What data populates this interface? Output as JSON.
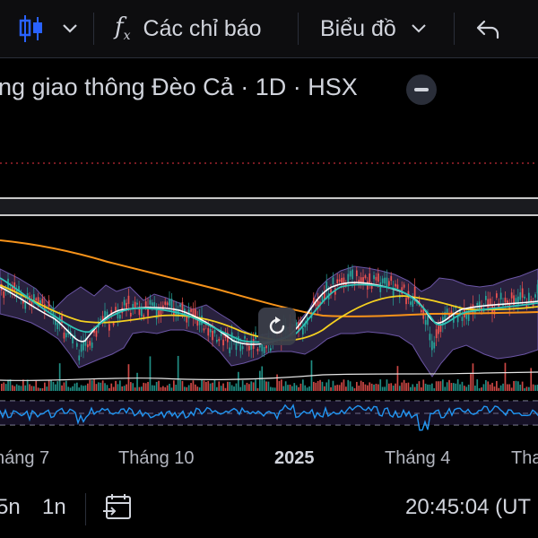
{
  "toolbar": {
    "chart_type_icon": "candlestick-icon",
    "dropdown_icon": "chevron-down-icon",
    "indicators_icon": "fx-icon",
    "indicators_label": "Các chỉ báo",
    "chart_menu_label": "Biểu đồ",
    "undo_icon": "undo-icon"
  },
  "symbol": {
    "title": "ng giao thông Đèo Cả · 1D · HSX",
    "collapse_icon": "minus-icon"
  },
  "time_axis": [
    "háng 7",
    "Tháng 10",
    "2025",
    "Tháng 4",
    "Tha"
  ],
  "bottom_bar": {
    "range_5n": "5n",
    "range_1n": "1n",
    "goto_date_icon": "calendar-arrow-icon",
    "clock": "20:45:04 (UT"
  },
  "colors": {
    "up": "#26a69a",
    "down": "#ef5350",
    "bollinger_fill": "#5c4a8a",
    "sma_long": "#f7931a",
    "sma_mid": "#f5d020",
    "ema_fast": "#ffffff",
    "ema_green": "#2ec4b6",
    "rsi_line": "#2196f3",
    "price_line": "#f23645"
  },
  "reset_icon": "reset-icon"
}
